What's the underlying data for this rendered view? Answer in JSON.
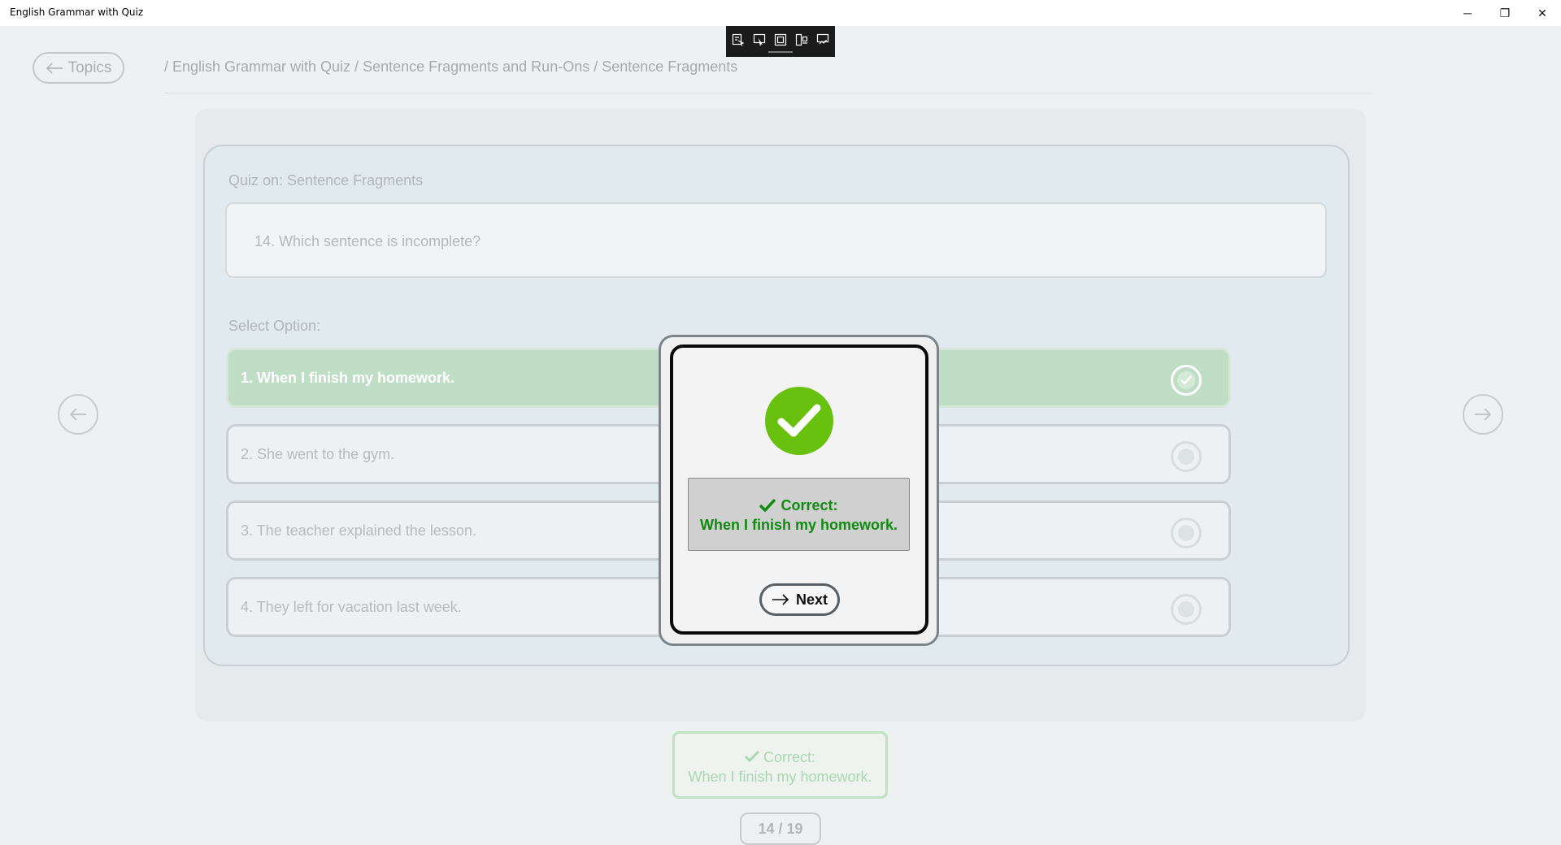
{
  "window": {
    "title": "English Grammar with Quiz",
    "minimize_glyph": "─",
    "maximize_glyph": "❐",
    "close_glyph": "✕"
  },
  "dev_toolbar": {
    "tools": [
      "select-element-icon",
      "pointer-icon",
      "frame-icon",
      "layout-adorner-icon",
      "track-focus-icon"
    ]
  },
  "header": {
    "back_label": "Topics",
    "breadcrumb": "/ English Grammar with Quiz / Sentence Fragments and Run-Ons / Sentence Fragments"
  },
  "quiz": {
    "heading": "Quiz on: Sentence Fragments",
    "question": "14.  Which sentence is incomplete?",
    "select_label": "Select Option:",
    "options": [
      {
        "label": "1. When I finish my homework.",
        "selected": true
      },
      {
        "label": "2. She went to the gym.",
        "selected": false
      },
      {
        "label": "3. The teacher explained the lesson.",
        "selected": false
      },
      {
        "label": "4. They left for vacation last week.",
        "selected": false
      }
    ]
  },
  "result": {
    "status": "Correct:",
    "answer": "When I finish my homework."
  },
  "pager": {
    "text": "14 / 19"
  },
  "modal": {
    "status": "Correct:",
    "answer": "When I finish my homework.",
    "next_label": "Next",
    "success_color": "#69c10f",
    "text_color": "#108a10"
  }
}
